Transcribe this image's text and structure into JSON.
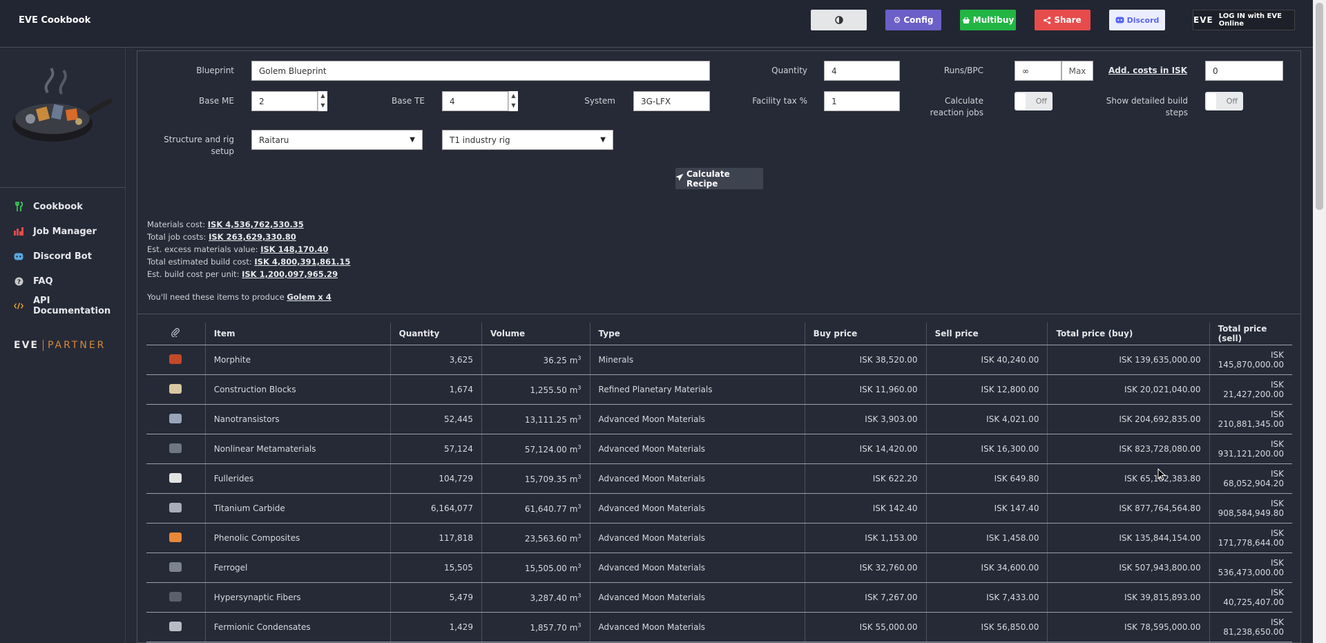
{
  "app": {
    "title": "EVE Cookbook"
  },
  "topbar": {
    "config_label": "Config",
    "multibuy_label": "Multibuy",
    "share_label": "Share",
    "discord_label": "Discord",
    "login_brand": "EVE",
    "login_label": "LOG IN with EVE Online"
  },
  "sidebar": {
    "items": [
      {
        "label": "Cookbook",
        "icon": "utensils-icon",
        "color": "#3ecf5a"
      },
      {
        "label": "Job Manager",
        "icon": "chart-icon",
        "color": "#e34b4b"
      },
      {
        "label": "Discord Bot",
        "icon": "discord-icon",
        "color": "#5aa7e0"
      },
      {
        "label": "FAQ",
        "icon": "question-icon",
        "color": "#c8c8c8"
      },
      {
        "label": "API Documentation",
        "icon": "code-icon",
        "color": "#e8a72c"
      }
    ],
    "partner_brand": "EVE",
    "partner_label": "PARTNER"
  },
  "form": {
    "blueprint_label": "Blueprint",
    "blueprint_value": "Golem Blueprint",
    "quantity_label": "Quantity",
    "quantity_value": "4",
    "runs_label": "Runs/BPC",
    "runs_value": "∞",
    "max_label": "Max",
    "addcosts_label": "Add. costs in ISK",
    "addcosts_value": "0",
    "base_me_label": "Base ME",
    "base_me_value": "2",
    "base_te_label": "Base TE",
    "base_te_value": "4",
    "system_label": "System",
    "system_value": "3G-LFX",
    "facility_tax_label": "Facility tax %",
    "facility_tax_value": "1",
    "reaction_label": "Calculate reaction jobs",
    "reaction_state": "Off",
    "detailed_label": "Show detailed build steps",
    "detailed_state": "Off",
    "structure_label": "Structure and rig setup",
    "structure_value": "Raitaru",
    "rig_value": "T1 industry rig",
    "calculate_label": "Calculate Recipe"
  },
  "costs": {
    "materials_label": "Materials cost:",
    "materials_value": "ISK 4,536,762,530.35",
    "jobs_label": "Total job costs:",
    "jobs_value": "ISK 263,629,330.80",
    "excess_label": "Est. excess materials value:",
    "excess_value": "ISK 148,170.40",
    "total_label": "Total estimated build cost:",
    "total_value": "ISK 4,800,391,861.15",
    "unit_label": "Est. build cost per unit:",
    "unit_value": "ISK 1,200,097,965.29",
    "need_label": "You'll need these items to produce",
    "need_value": "Golem x 4"
  },
  "table": {
    "headers": [
      "Item",
      "Quantity",
      "Volume",
      "Type",
      "Buy price",
      "Sell price",
      "Total price (buy)",
      "Total price (sell)"
    ],
    "volume_unit": "m",
    "volume_exp": "3",
    "rows": [
      {
        "item": "Morphite",
        "qty": "3,625",
        "vol": "36.25",
        "type": "Minerals",
        "buy": "ISK 38,520.00",
        "sell": "ISK 40,240.00",
        "tbuy": "ISK 139,635,000.00",
        "tsell": "ISK 145,870,000.00",
        "color": "#c24a2b"
      },
      {
        "item": "Construction Blocks",
        "qty": "1,674",
        "vol": "1,255.50",
        "type": "Refined Planetary Materials",
        "buy": "ISK 11,960.00",
        "sell": "ISK 12,800.00",
        "tbuy": "ISK 20,021,040.00",
        "tsell": "ISK 21,427,200.00",
        "color": "#d8c9a0"
      },
      {
        "item": "Nanotransistors",
        "qty": "52,445",
        "vol": "13,111.25",
        "type": "Advanced Moon Materials",
        "buy": "ISK 3,903.00",
        "sell": "ISK 4,021.00",
        "tbuy": "ISK 204,692,835.00",
        "tsell": "ISK 210,881,345.00",
        "color": "#9aa4b8"
      },
      {
        "item": "Nonlinear Metamaterials",
        "qty": "57,124",
        "vol": "57,124.00",
        "type": "Advanced Moon Materials",
        "buy": "ISK 14,420.00",
        "sell": "ISK 16,300.00",
        "tbuy": "ISK 823,728,080.00",
        "tsell": "ISK 931,121,200.00",
        "color": "#6f7684"
      },
      {
        "item": "Fullerides",
        "qty": "104,729",
        "vol": "15,709.35",
        "type": "Advanced Moon Materials",
        "buy": "ISK 622.20",
        "sell": "ISK 649.80",
        "tbuy": "ISK 65,162,383.80",
        "tsell": "ISK 68,052,904.20",
        "color": "#e3e3e3"
      },
      {
        "item": "Titanium Carbide",
        "qty": "6,164,077",
        "vol": "61,640.77",
        "type": "Advanced Moon Materials",
        "buy": "ISK 142.40",
        "sell": "ISK 147.40",
        "tbuy": "ISK 877,764,564.80",
        "tsell": "ISK 908,584,949.80",
        "color": "#a8adb7"
      },
      {
        "item": "Phenolic Composites",
        "qty": "117,818",
        "vol": "23,563.60",
        "type": "Advanced Moon Materials",
        "buy": "ISK 1,153.00",
        "sell": "ISK 1,458.00",
        "tbuy": "ISK 135,844,154.00",
        "tsell": "ISK 171,778,644.00",
        "color": "#e8883a"
      },
      {
        "item": "Ferrogel",
        "qty": "15,505",
        "vol": "15,505.00",
        "type": "Advanced Moon Materials",
        "buy": "ISK 32,760.00",
        "sell": "ISK 34,600.00",
        "tbuy": "ISK 507,943,800.00",
        "tsell": "ISK 536,473,000.00",
        "color": "#7c8391"
      },
      {
        "item": "Hypersynaptic Fibers",
        "qty": "5,479",
        "vol": "3,287.40",
        "type": "Advanced Moon Materials",
        "buy": "ISK 7,267.00",
        "sell": "ISK 7,433.00",
        "tbuy": "ISK 39,815,893.00",
        "tsell": "ISK 40,725,407.00",
        "color": "#5a606c"
      },
      {
        "item": "Fermionic Condensates",
        "qty": "1,429",
        "vol": "1,857.70",
        "type": "Advanced Moon Materials",
        "buy": "ISK 55,000.00",
        "sell": "ISK 56,850.00",
        "tbuy": "ISK 78,595,000.00",
        "tsell": "ISK 81,238,650.00",
        "color": "#b8bcc5"
      }
    ]
  }
}
